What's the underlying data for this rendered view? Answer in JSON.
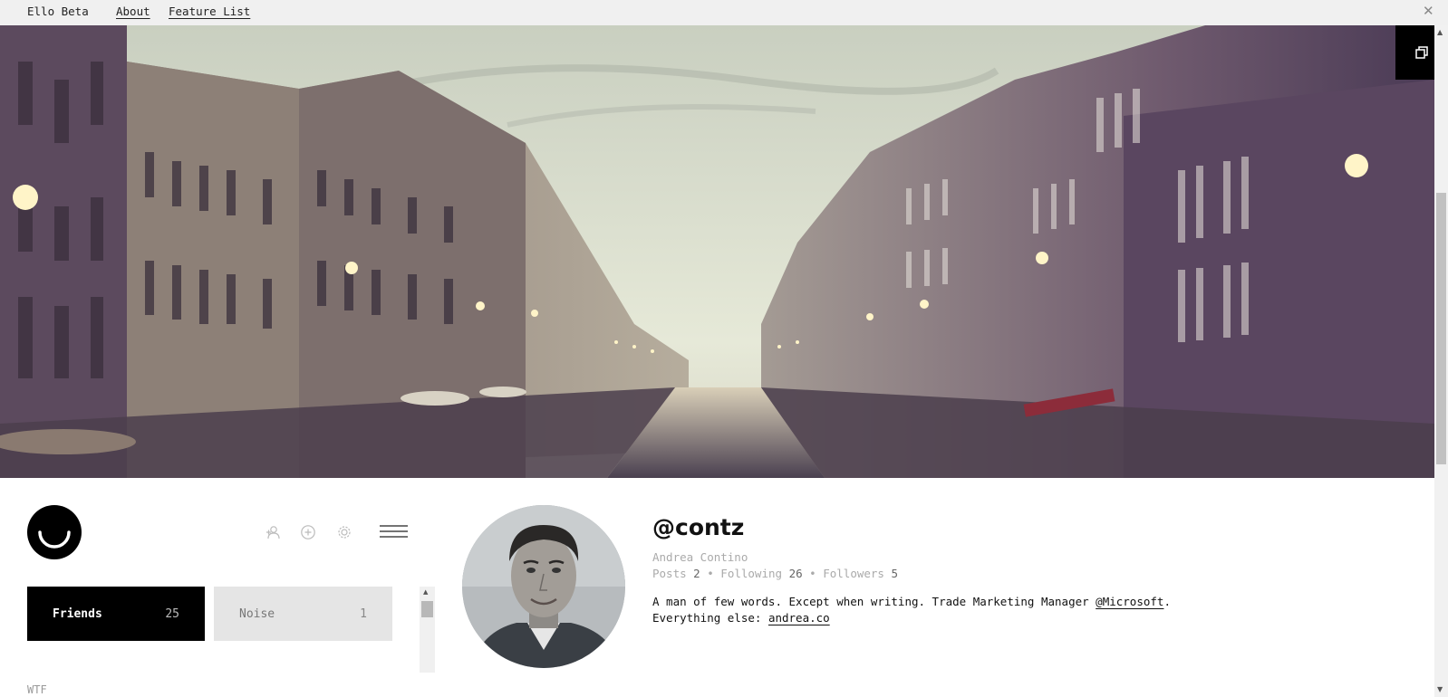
{
  "topbar": {
    "brand": "Ello Beta",
    "nav": [
      "About",
      "Feature List"
    ]
  },
  "icons": {
    "close": "close-icon",
    "view_toggle": "overlap-squares-icon",
    "logo": "ello-smile-logo",
    "invite": "add-person-icon",
    "create": "plus-circle-icon",
    "settings": "gear-icon",
    "menu": "hamburger-menu-icon"
  },
  "colors": {
    "accent": "#000000",
    "tab_active_bg": "#000000",
    "tab_inactive_bg": "#e5e5e5",
    "muted_text": "#aaaaaa"
  },
  "sidebar": {
    "tabs": [
      {
        "label": "Friends",
        "count": "25",
        "active": true
      },
      {
        "label": "Noise",
        "count": "1",
        "active": false
      }
    ],
    "section_label": "WTF"
  },
  "profile": {
    "username": "@contz",
    "full_name": "Andrea Contino",
    "stats": {
      "posts_label": "Posts",
      "posts": "2",
      "following_label": "Following",
      "following": "26",
      "followers_label": "Followers",
      "followers": "5",
      "separator": "•"
    },
    "bio": {
      "line1_text": "A man of few words. Except when writing. Trade Marketing Manager ",
      "line1_link": "@Microsoft",
      "line1_end": ".",
      "line2_text": "Everything else: ",
      "line2_link": "andrea.co"
    }
  }
}
